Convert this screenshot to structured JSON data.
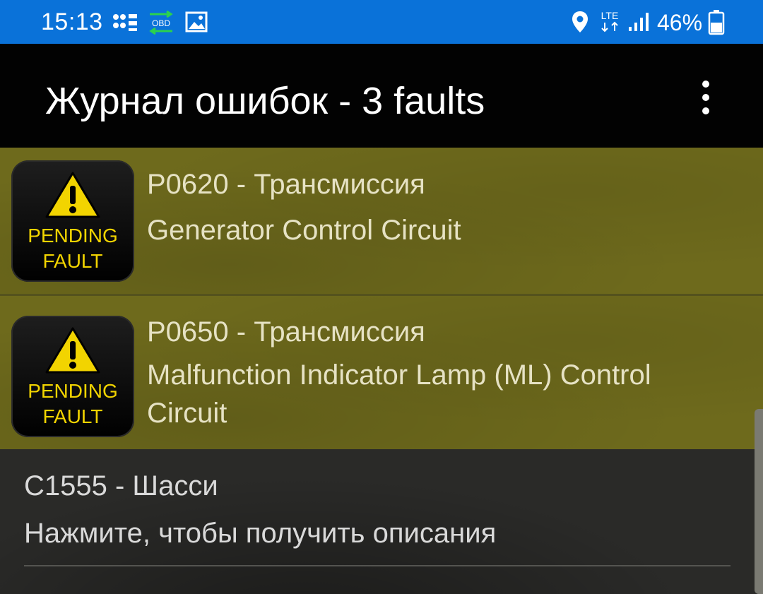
{
  "status_bar": {
    "time": "15:13",
    "obd_label": "OBD",
    "network_label": "LTE",
    "battery_percent": "46%",
    "icons": [
      "notification-dots-icon",
      "obd-connection-icon",
      "gallery-icon",
      "location-icon",
      "lte-icon",
      "signal-icon",
      "battery-icon"
    ],
    "background_color": "#0a72d9"
  },
  "app_bar": {
    "title": "Журнал ошибок - 3 faults",
    "menu_icon": "overflow-menu-icon"
  },
  "faults": [
    {
      "badge_line1": "PENDING",
      "badge_line2": "FAULT",
      "code_title": "P0620 - Трансмиссия",
      "description": "Generator Control Circuit"
    },
    {
      "badge_line1": "PENDING",
      "badge_line2": "FAULT",
      "code_title": "P0650 - Трансмиссия",
      "description": "Malfunction Indicator Lamp (ML) Control Circuit"
    },
    {
      "code_title": "C1555 - Шасси",
      "description": "Нажмите, чтобы получить описания"
    }
  ],
  "colors": {
    "pending_background": "#6e6a1c",
    "badge_text": "#f2d400",
    "warning_triangle": "#f2d400"
  }
}
